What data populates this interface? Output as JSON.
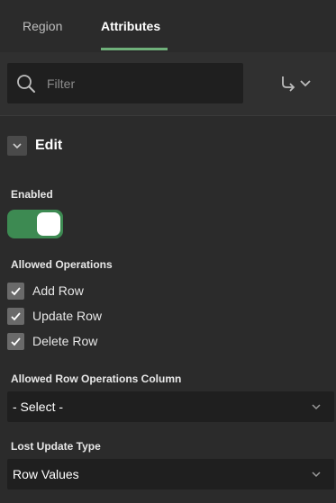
{
  "tabs": [
    {
      "label": "Region",
      "active": false
    },
    {
      "label": "Attributes",
      "active": true
    }
  ],
  "toolbar": {
    "search_placeholder": "Filter",
    "search_icon": "search-icon",
    "goto_icon": "go-to-group-icon"
  },
  "group": {
    "title": "Edit",
    "expanded": true
  },
  "enabled": {
    "label": "Enabled",
    "value": true
  },
  "allowed_operations": {
    "label": "Allowed Operations",
    "items": [
      {
        "label": "Add Row",
        "checked": true
      },
      {
        "label": "Update Row",
        "checked": true
      },
      {
        "label": "Delete Row",
        "checked": true
      }
    ]
  },
  "row_ops_column": {
    "label": "Allowed Row Operations Column",
    "value": "- Select -"
  },
  "lost_update_type": {
    "label": "Lost Update Type",
    "value": "Row Values"
  },
  "colors": {
    "accent": "#6fb07a",
    "toggle_on": "#3d8a52",
    "background": "#2b2b2b",
    "field": "#1f1f1f"
  }
}
